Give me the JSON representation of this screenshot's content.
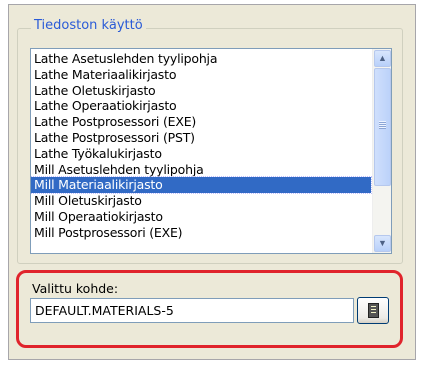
{
  "group": {
    "title": "Tiedoston käyttö"
  },
  "list": {
    "items": [
      "Lathe Asetuslehden tyylipohja",
      "Lathe Materiaalikirjasto",
      "Lathe Oletuskirjasto",
      "Lathe Operaatiokirjasto",
      "Lathe Postprosessori (EXE)",
      "Lathe Postprosessori (PST)",
      "Lathe Työkalukirjasto",
      "Mill Asetuslehden tyylipohja",
      "Mill Materiaalikirjasto",
      "Mill Oletuskirjasto",
      "Mill Operaatiokirjasto",
      "Mill Postprosessori (EXE)"
    ],
    "selected": "Mill Materiaalikirjasto"
  },
  "selection": {
    "label": "Valittu kohde:",
    "value": "DEFAULT.MATERIALS-5"
  },
  "icons": {
    "scroll_up": "chevron-up-icon",
    "scroll_down": "chevron-down-icon",
    "browse": "book-icon"
  },
  "colors": {
    "selection_highlight": "#316ac5",
    "annotation_frame": "#e0242c",
    "group_title": "#2a5bd7"
  }
}
